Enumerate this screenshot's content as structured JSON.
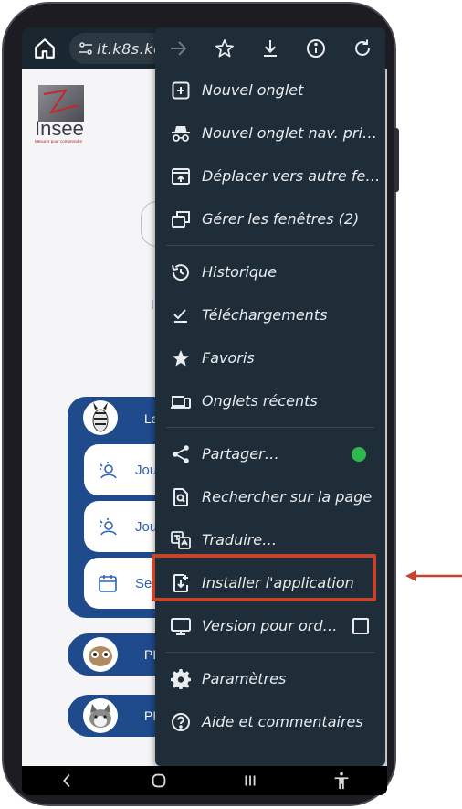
{
  "browser": {
    "url": "lt.k8s.ke"
  },
  "page": {
    "logo_text": "Insee",
    "logo_tagline": "Mesurer pour comprendre",
    "panel_label": "La",
    "cards": [
      {
        "label": "Jou",
        "icon": "sun-person-icon"
      },
      {
        "label": "Jou",
        "icon": "sun-person-icon"
      },
      {
        "label": "Sen",
        "icon": "calendar-icon"
      }
    ],
    "pills": [
      {
        "label": "PE"
      },
      {
        "label": "PE"
      }
    ]
  },
  "menu": {
    "top_icons": [
      "forward-arrow-icon",
      "star-icon",
      "download-icon",
      "info-icon",
      "refresh-icon"
    ],
    "items": [
      {
        "label": "Nouvel onglet",
        "icon": "plus-square-icon"
      },
      {
        "label": "Nouvel onglet nav. pri…",
        "icon": "incognito-icon"
      },
      {
        "label": "Déplacer vers autre fe…",
        "icon": "move-window-icon"
      },
      {
        "label": "Gérer les fenêtres (2)",
        "icon": "windows-icon"
      },
      {
        "label": "Historique",
        "icon": "history-icon"
      },
      {
        "label": "Téléchargements",
        "icon": "downloads-check-icon"
      },
      {
        "label": "Favoris",
        "icon": "star-icon"
      },
      {
        "label": "Onglets récents",
        "icon": "devices-icon"
      },
      {
        "label": "Partager…",
        "icon": "share-icon"
      },
      {
        "label": "Rechercher sur la page",
        "icon": "find-in-page-icon"
      },
      {
        "label": "Traduire…",
        "icon": "translate-icon"
      },
      {
        "label": "Installer l'application",
        "icon": "install-app-icon"
      },
      {
        "label": "Version pour ord…",
        "icon": "desktop-icon"
      },
      {
        "label": "Paramètres",
        "icon": "gear-icon"
      },
      {
        "label": "Aide et commentaires",
        "icon": "help-icon"
      }
    ]
  },
  "colors": {
    "menu_bg": "#1f2d38",
    "highlight": "#c4452c",
    "panel_blue": "#1f4a8c"
  }
}
